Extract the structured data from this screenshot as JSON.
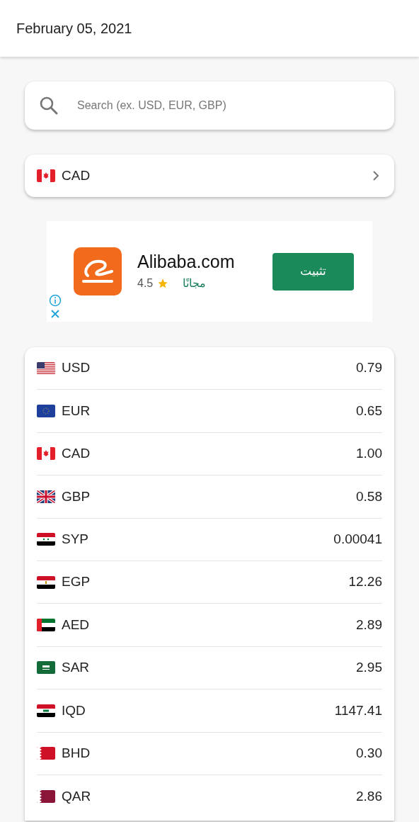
{
  "header": {
    "date": "February 05, 2021"
  },
  "search": {
    "placeholder": "Search (ex. USD, EUR, GBP)"
  },
  "base_currency": {
    "code": "CAD"
  },
  "ad": {
    "app_name": "Alibaba.com",
    "rating": "4.5",
    "price": "مجانًا",
    "install_button": "تثبيت"
  },
  "rates": [
    {
      "code": "USD",
      "value": "0.79"
    },
    {
      "code": "EUR",
      "value": "0.65"
    },
    {
      "code": "CAD",
      "value": "1.00"
    },
    {
      "code": "GBP",
      "value": "0.58"
    },
    {
      "code": "SYP",
      "value": "0.00041"
    },
    {
      "code": "EGP",
      "value": "12.26"
    },
    {
      "code": "AED",
      "value": "2.89"
    },
    {
      "code": "SAR",
      "value": "2.95"
    },
    {
      "code": "IQD",
      "value": "1147.41"
    },
    {
      "code": "BHD",
      "value": "0.30"
    },
    {
      "code": "QAR",
      "value": "2.86"
    }
  ]
}
